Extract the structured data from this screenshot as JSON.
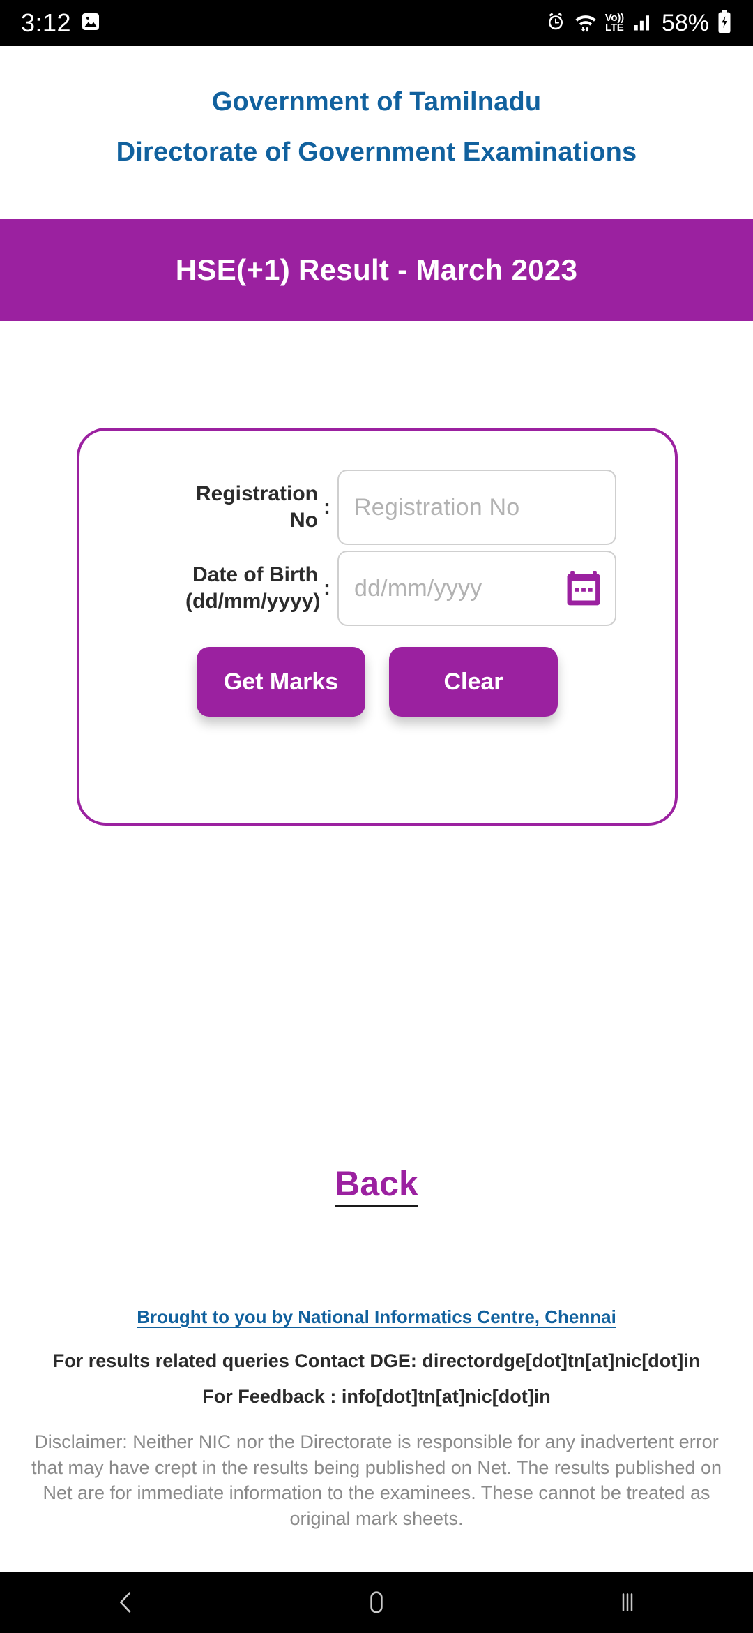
{
  "statusbar": {
    "time": "3:12",
    "battery_percent": "58%",
    "volte_top": "Vo))",
    "volte_bottom": "LTE",
    "icons": [
      "image-icon",
      "alarm-icon",
      "wifi-icon",
      "volte-icon",
      "signal-icon",
      "battery-charging-icon"
    ]
  },
  "header": {
    "line1": "Government of Tamilnadu",
    "line2": "Directorate of Government Examinations",
    "color": "#11619e"
  },
  "banner": {
    "title": "HSE(+1)  Result - March 2023",
    "background": "#9b21a0",
    "text_color": "#ffffff"
  },
  "form": {
    "border_color": "#9b21a0",
    "registration": {
      "label": "Registration No",
      "colon": ":",
      "value": "",
      "placeholder": "Registration No"
    },
    "dob": {
      "label_line1": "Date of Birth",
      "label_line2": "(dd/mm/yyyy)",
      "colon": ":",
      "value": "",
      "placeholder": "dd/mm/yyyy",
      "calendar_icon_color": "#9b21a0"
    },
    "buttons": {
      "submit": "Get Marks",
      "clear": "Clear",
      "color": "#9b21a0"
    }
  },
  "back": {
    "label": "Back",
    "color": "#9b21a0"
  },
  "footer": {
    "nic_credit": "Brought to you by National Informatics Centre, Chennai",
    "contact": "For results related queries Contact DGE:  directordge[dot]tn[at]nic[dot]in",
    "feedback": "For Feedback : info[dot]tn[at]nic[dot]in",
    "disclaimer": "Disclaimer: Neither NIC nor the Directorate is responsible for any inadvertent error that may have crept in the results being published on Net. The results published on Net are for immediate information to the examinees. These cannot be treated as original mark sheets."
  },
  "navbar": {
    "back": "back-nav-icon",
    "home": "home-nav-icon",
    "recents": "recents-nav-icon"
  }
}
